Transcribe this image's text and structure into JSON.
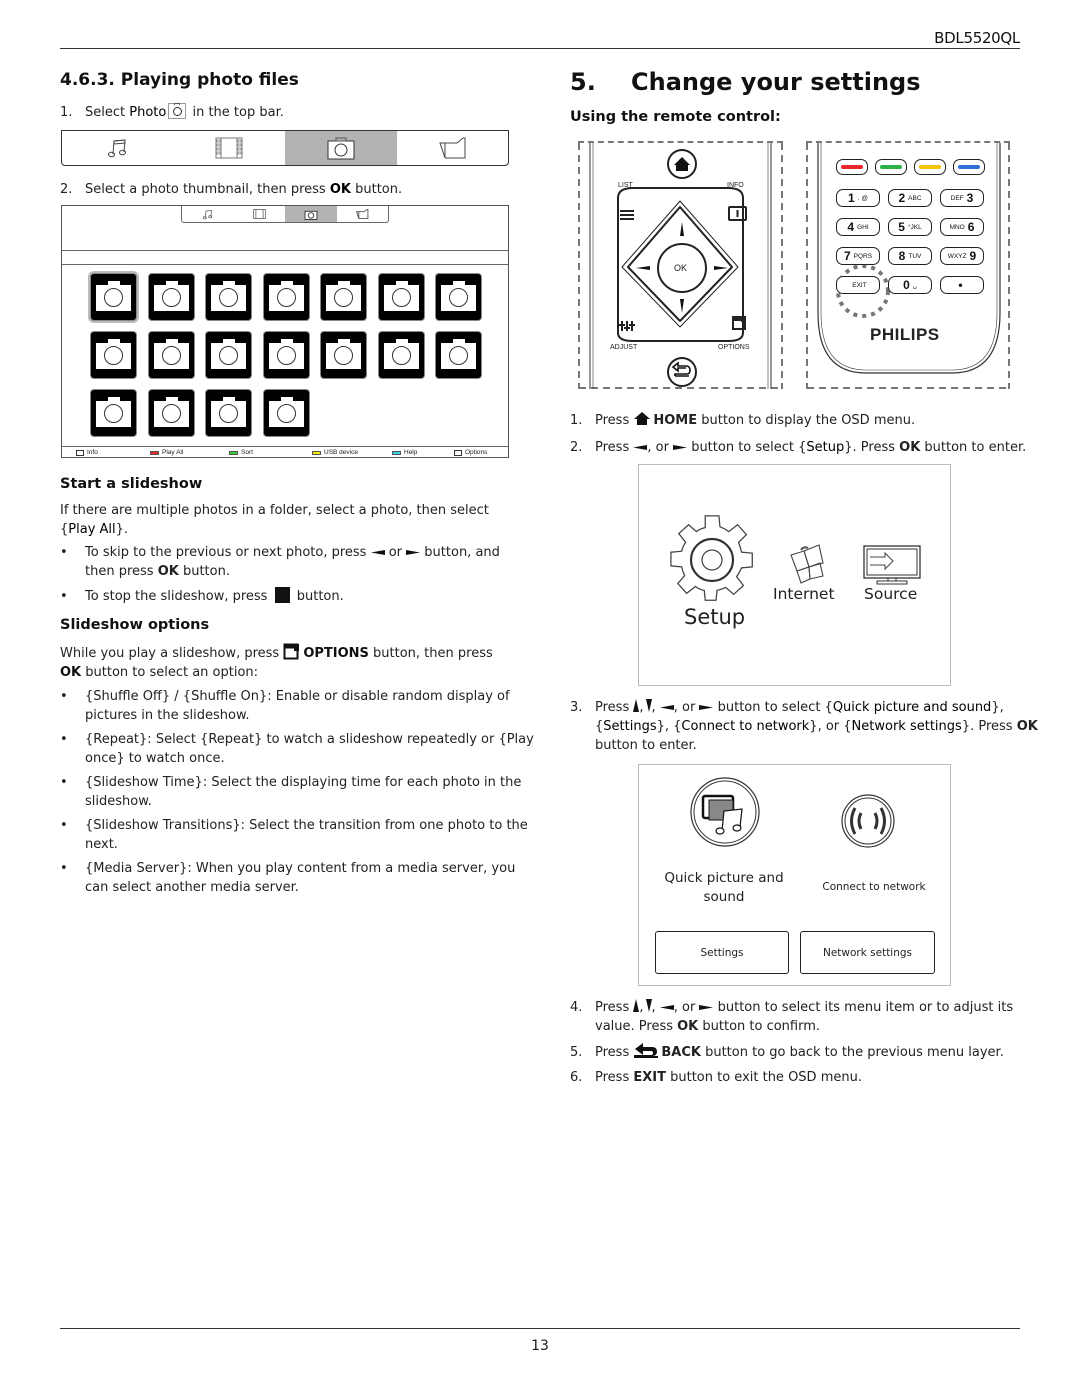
{
  "header": {
    "model": "BDL5520QL"
  },
  "footer": {
    "page_number": "13"
  },
  "left": {
    "section_title": "4.6.3.  Playing photo files",
    "step1": {
      "num": "1.",
      "pre": "Select ",
      "kw": "Photo",
      "post": " in the top bar."
    },
    "media_bar": {
      "items": [
        {
          "name": "music",
          "icon": "music-note-icon"
        },
        {
          "name": "video",
          "icon": "film-strip-icon"
        },
        {
          "name": "photo",
          "icon": "camera-icon",
          "active": true
        },
        {
          "name": "folder",
          "icon": "folder-icon"
        }
      ]
    },
    "step2": {
      "num": "2.",
      "pre": "Select a photo thumbnail, then press ",
      "kw": "OK",
      "post": " button."
    },
    "screen": {
      "thumbnail_count": 18,
      "selected_index": 0,
      "legend": [
        {
          "label": "Info",
          "icon": "info-icon"
        },
        {
          "label": "Play All",
          "color": "#e8262b"
        },
        {
          "label": "Sort",
          "color": "#33cc33"
        },
        {
          "label": "USB device",
          "color": "#f2e600"
        },
        {
          "label": "Help",
          "color": "#33d6e6"
        },
        {
          "label": "Options",
          "icon": "options-icon"
        }
      ]
    },
    "slideshow": {
      "title": "Start a slideshow",
      "intro_pre": "If there are multiple photos in a folder, select a photo, then select {",
      "intro_kw": "Play All",
      "intro_post": "}.",
      "bullets": [
        {
          "pre": "To skip to the previous or next photo, press ",
          "mid": " or ",
          "post": " button, and",
          "line2_pre": "then press ",
          "line2_kw": "OK",
          "line2_post": " button."
        },
        {
          "pre": "To stop the slideshow, press ",
          "post": " button."
        }
      ]
    },
    "options": {
      "title": "Slideshow options",
      "intro_pre": "While you play a slideshow, press ",
      "intro_kw": "OPTIONS",
      "intro_post": " button, then press",
      "intro_line2_kw": "OK",
      "intro_line2_post": " button to select an option:",
      "bullets": [
        {
          "l1": "{Shuffle Off} / {Shuffle On}: Enable or disable random display of",
          "l2": "pictures in the slideshow."
        },
        {
          "l1": "{Repeat}: Select {Repeat} to watch a slideshow repeatedly or {Play",
          "l2": "once} to watch once."
        },
        {
          "l1": "{Slideshow Time}: Select the displaying time for each photo in the",
          "l2": "slideshow."
        },
        {
          "l1": "{Slideshow Transitions}: Select the transition from one photo to the",
          "l2": "next."
        },
        {
          "l1": "{Media Server}: When you play content from a media server, you",
          "l2": "can select another media server."
        }
      ],
      "bullet_char": "•"
    }
  },
  "right": {
    "chapter_num": "5.",
    "chapter_title": "Change your settings",
    "subtitle": "Using the remote control:",
    "remote_left": {
      "labels": {
        "list": "LIST",
        "info": "INFO",
        "adjust": "ADJUST",
        "options": "OPTIONS",
        "ok": "OK"
      }
    },
    "remote_right": {
      "color_keys": [
        "#e8262b",
        "#2bb34a",
        "#f5c400",
        "#2f6fd9"
      ],
      "keys": [
        {
          "big": "1",
          "small": ". @"
        },
        {
          "big": "2",
          "small": "ABC"
        },
        {
          "big": "3",
          "small": "DEF",
          "small_first": true
        },
        {
          "big": "4",
          "small": "GHI"
        },
        {
          "big": "5",
          "small": "°JKL"
        },
        {
          "big": "6",
          "small": "MNO",
          "small_first": true
        },
        {
          "big": "7",
          "small": "PQRS"
        },
        {
          "big": "8",
          "small": "TUV"
        },
        {
          "big": "9",
          "small": "WXYZ",
          "small_first": true
        },
        {
          "big": "",
          "small": "EXIT"
        },
        {
          "big": "0",
          "small": "␣"
        },
        {
          "big": "•",
          "small": ""
        }
      ],
      "brand": "PHILIPS"
    },
    "steps": [
      {
        "num": "1.",
        "pre": "Press ",
        "kw": "HOME",
        "post": " button to display the OSD menu."
      },
      {
        "num": "2.",
        "pre": "Press ",
        "mid": ", or ",
        "post1": " button to select {",
        "kw1": "Setup",
        "post2": "}. Press ",
        "kw2": "OK",
        "post3": " button to enter."
      }
    ],
    "osd1": {
      "setup": "Setup",
      "internet": "Internet",
      "source": "Source"
    },
    "step3": {
      "num": "3.",
      "l1_pre": "Press ",
      "l1_post": ", or ",
      "l1_post2": " button to select {",
      "kw1": "Quick picture and sound",
      "l1_end": "},",
      "l2_a": "{",
      "kw2": "Settings",
      "l2_b": "}, {",
      "kw3": "Connect to network",
      "l2_c": "}, or {",
      "kw4": "Network settings",
      "l2_d": "}. Press ",
      "kw5": "OK",
      "l3": "button to enter."
    },
    "osd2": {
      "quick": "Quick picture and sound",
      "quick_l1": "Quick picture and",
      "quick_l2": "sound",
      "connect": "Connect to network",
      "settings_btn": "Settings",
      "network_btn": "Network settings"
    },
    "step4": {
      "num": "4.",
      "pre": "Press ",
      "mid": ", or ",
      "post": " button to select its menu item or to adjust its",
      "l2_pre": "value. Press ",
      "kw": "OK",
      "l2_post": " button to confirm."
    },
    "step5": {
      "num": "5.",
      "pre": "Press ",
      "kw": "BACK",
      "post": " button to go back to the previous menu layer."
    },
    "step6": {
      "num": "6.",
      "pre": "Press ",
      "kw": "EXIT",
      "post": " button to exit the OSD menu."
    }
  }
}
